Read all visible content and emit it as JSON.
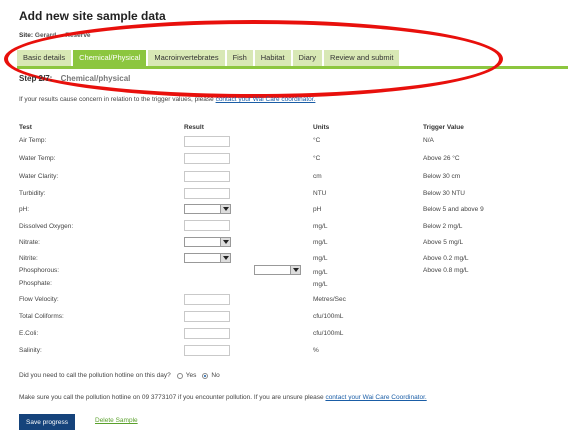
{
  "page_title": "Add new site sample data",
  "site": {
    "label": "Site:",
    "value": "Gerard ... Reserve"
  },
  "tabs": [
    {
      "label": "Basic details",
      "active": false
    },
    {
      "label": "Chemical/Physical",
      "active": true
    },
    {
      "label": "Macroinvertebrates",
      "active": false
    },
    {
      "label": "Fish",
      "active": false
    },
    {
      "label": "Habitat",
      "active": false
    },
    {
      "label": "Diary",
      "active": false
    },
    {
      "label": "Review and submit",
      "active": false
    }
  ],
  "step": {
    "number": "Step 2/7:",
    "label": "Chemical/physical"
  },
  "notice": {
    "text": "If your results cause concern in relation to the trigger values, please ",
    "link": "contact your Wai Care coordinator."
  },
  "table": {
    "headers": {
      "test": "Test",
      "result": "Result",
      "units": "Units",
      "trigger": "Trigger Value"
    },
    "rows": [
      {
        "test": "Air Temp:",
        "units": "°C",
        "trigger": "N/A"
      },
      {
        "test": "Water Temp:",
        "units": "°C",
        "trigger": "Above 26 °C"
      },
      {
        "test": "Water Clarity:",
        "units": "cm",
        "trigger": "Below 30 cm"
      },
      {
        "test": "Turbidity:",
        "units": "NTU",
        "trigger": "Below 30 NTU"
      },
      {
        "test": "pH:",
        "units": "pH",
        "trigger": "Below 5 and above 9"
      },
      {
        "test": "Dissolved Oxygen:",
        "units": "mg/L",
        "trigger": "Below 2 mg/L"
      },
      {
        "test": "Nitrate:",
        "units": "mg/L",
        "trigger": "Above 5 mg/L"
      },
      {
        "test": "Nitrite:",
        "units": "mg/L",
        "trigger": "Above 0.2 mg/L"
      },
      {
        "test": "Phosphorous:",
        "units": "mg/L",
        "trigger": "Above 0.8 mg/L"
      },
      {
        "test": "Phosphate:",
        "units": "mg/L",
        "trigger": ""
      },
      {
        "test": "Flow Velocity:",
        "units": "Metres/Sec",
        "trigger": ""
      },
      {
        "test": "Total Coliforms:",
        "units": "cfu/100mL",
        "trigger": ""
      },
      {
        "test": "E.Coli:",
        "units": "cfu/100mL",
        "trigger": ""
      },
      {
        "test": "Salinity:",
        "units": "%",
        "trigger": ""
      }
    ]
  },
  "hotline_question": {
    "text": "Did you need to call the pollution hotline on this day?",
    "options": [
      "Yes",
      "No"
    ],
    "selected": "No"
  },
  "hotline_note": {
    "text": "Make sure you call the pollution hotline on 09 3773107 if you encounter pollution. If you are unsure please ",
    "link": "contact your Wai Care Coordinator."
  },
  "buttons": {
    "save": "Save progress",
    "delete": "Delete Sample"
  },
  "colors": {
    "tab_active": "#8cc63f",
    "tab_inactive": "#d8e8b5",
    "annotation_oval": "#e8100c",
    "button": "#15437b",
    "link": "#1a5da6"
  }
}
